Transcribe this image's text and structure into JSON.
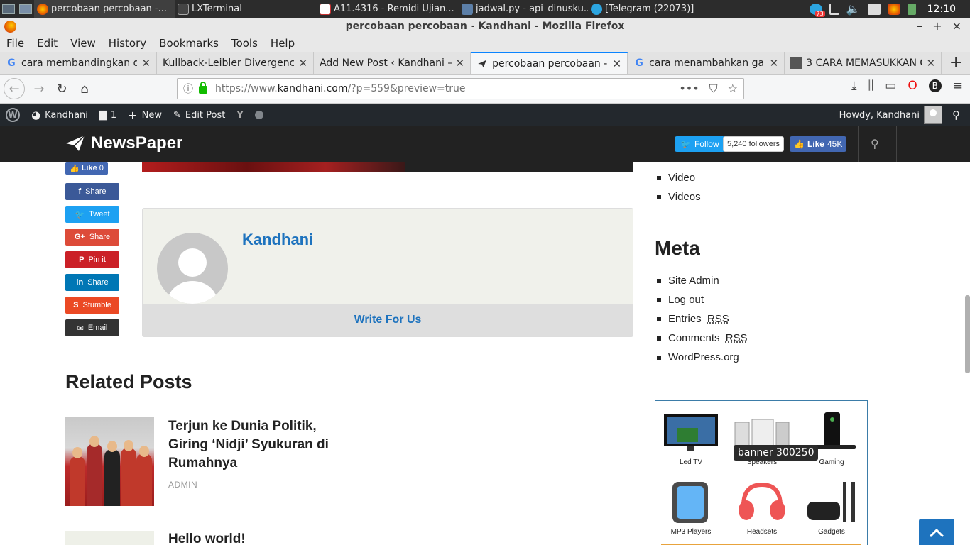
{
  "taskbar": {
    "tasks": [
      {
        "label": "percobaan percobaan -..."
      },
      {
        "label": "LXTerminal"
      },
      {
        "label": "A11.4316 - Remidi Ujian..."
      },
      {
        "label": "jadwal.py - api_dinusku..."
      },
      {
        "label": "[Telegram (22073)]"
      }
    ],
    "badge": "73",
    "clock": "12:10"
  },
  "window": {
    "title": "percobaan percobaan - Kandhani - Mozilla Firefox"
  },
  "menu": [
    "File",
    "Edit",
    "View",
    "History",
    "Bookmarks",
    "Tools",
    "Help"
  ],
  "tabs": [
    {
      "label": "cara membandingkan du",
      "favicon": "google"
    },
    {
      "label": "Kullback-Leibler Divergence",
      "favicon": "none"
    },
    {
      "label": "Add New Post ‹ Kandhani —",
      "favicon": "none"
    },
    {
      "label": "percobaan percobaan - K",
      "favicon": "newspaper",
      "active": true
    },
    {
      "label": "cara menambahkan gam",
      "favicon": "google"
    },
    {
      "label": "3 CARA MEMASUKKAN G",
      "favicon": "image"
    }
  ],
  "address": {
    "prefix": "https://www.",
    "host": "kandhani.com",
    "path": "/?p=559&preview=true"
  },
  "wp_admin_bar": {
    "site": "Kandhani",
    "comments": "1",
    "new": "New",
    "edit": "Edit Post",
    "howdy": "Howdy, Kandhani"
  },
  "site_header": {
    "logo": "NewsPaper",
    "twitter_follow": "Follow",
    "twitter_followers": "5,240 followers",
    "fb_like": "Like",
    "fb_count": "45K"
  },
  "share": {
    "fb_like": "Like",
    "fb_like_count": "0",
    "buttons": [
      {
        "label": "Share",
        "network": "facebook",
        "color": "#3b5998"
      },
      {
        "label": "Tweet",
        "network": "twitter",
        "color": "#1da1f2"
      },
      {
        "label": "Share",
        "network": "google-plus",
        "color": "#dd4b39"
      },
      {
        "label": "Pin it",
        "network": "pinterest",
        "color": "#cb2027"
      },
      {
        "label": "Share",
        "network": "linkedin",
        "color": "#0077b5"
      },
      {
        "label": "Stumble",
        "network": "stumbleupon",
        "color": "#eb4924"
      },
      {
        "label": "Email",
        "network": "email",
        "color": "#333333"
      }
    ]
  },
  "author": {
    "name": "Kandhani",
    "footer_link": "Write For Us"
  },
  "related": {
    "heading": "Related Posts",
    "posts": [
      {
        "title": "Terjun ke Dunia Politik, Giring ‘Nidji’ Syukuran di Rumahnya",
        "author": "ADMIN"
      },
      {
        "title": "Hello world!",
        "author": ""
      }
    ]
  },
  "sidebar": {
    "categories": [
      "Video",
      "Videos"
    ],
    "meta_heading": "Meta",
    "meta_links": [
      {
        "pre": "Site Admin",
        "abbr": ""
      },
      {
        "pre": "Log out",
        "abbr": ""
      },
      {
        "pre": "Entries ",
        "abbr": "RSS"
      },
      {
        "pre": "Comments ",
        "abbr": "RSS"
      },
      {
        "pre": "WordPress.org",
        "abbr": ""
      }
    ],
    "banner": {
      "tooltip": "banner 300250",
      "items": [
        "Led TV",
        "Speakers",
        "Gaming",
        "MP3 Players",
        "Headsets",
        "Gadgets"
      ]
    }
  }
}
